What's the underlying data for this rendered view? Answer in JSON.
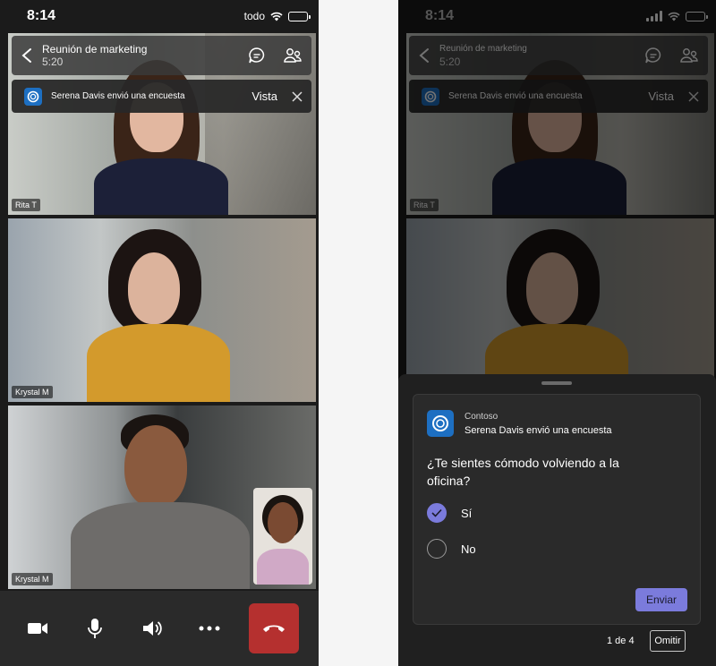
{
  "status": {
    "time": "8:14",
    "carrier": "todo"
  },
  "meeting": {
    "title": "Reunión de marketing",
    "duration": "5:20"
  },
  "notification": {
    "text": "Serena Davis envió una encuesta",
    "view_label": "Vista"
  },
  "participants": {
    "tile1": "Rita T",
    "tile2": "Krystal M",
    "tile3": "Krystal M"
  },
  "poll": {
    "app_name": "Contoso",
    "sender_text": "Serena Davis envió una encuesta",
    "question": "¿Te sientes cómodo volviendo a la oficina?",
    "options": [
      {
        "label": "Sí",
        "selected": true
      },
      {
        "label": "No",
        "selected": false
      }
    ],
    "submit_label": "Enviar",
    "pager": "1 de 4",
    "skip_label": "Omitir"
  },
  "colors": {
    "accent": "#7b7bdc",
    "hangup": "#b5302f",
    "app_icon": "#1d6fc2"
  }
}
